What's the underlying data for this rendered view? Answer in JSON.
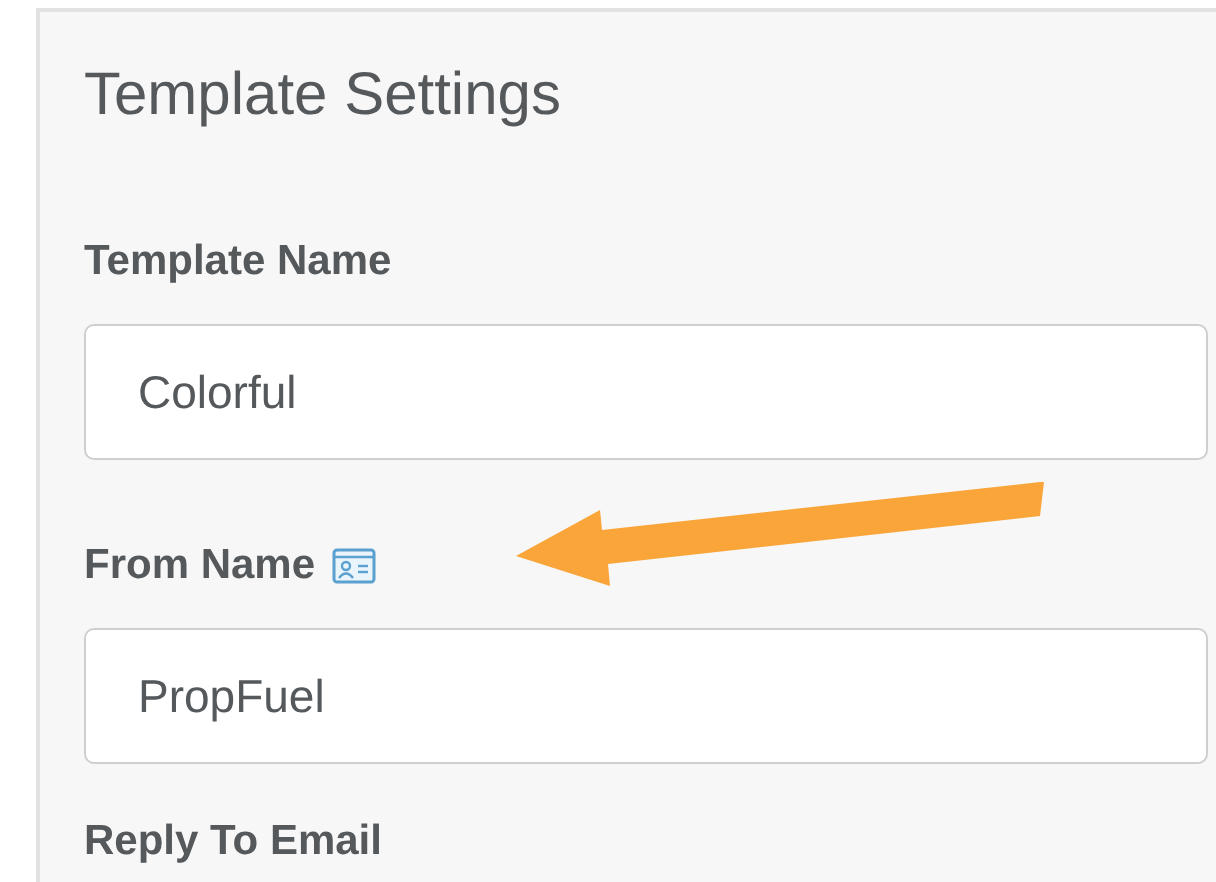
{
  "panel": {
    "title": "Template Settings"
  },
  "fields": [
    {
      "label": "Template Name",
      "value": "Colorful",
      "has_icon": false
    },
    {
      "label": "From Name",
      "value": "PropFuel",
      "has_icon": true
    },
    {
      "label": "Reply To Email"
    }
  ]
}
